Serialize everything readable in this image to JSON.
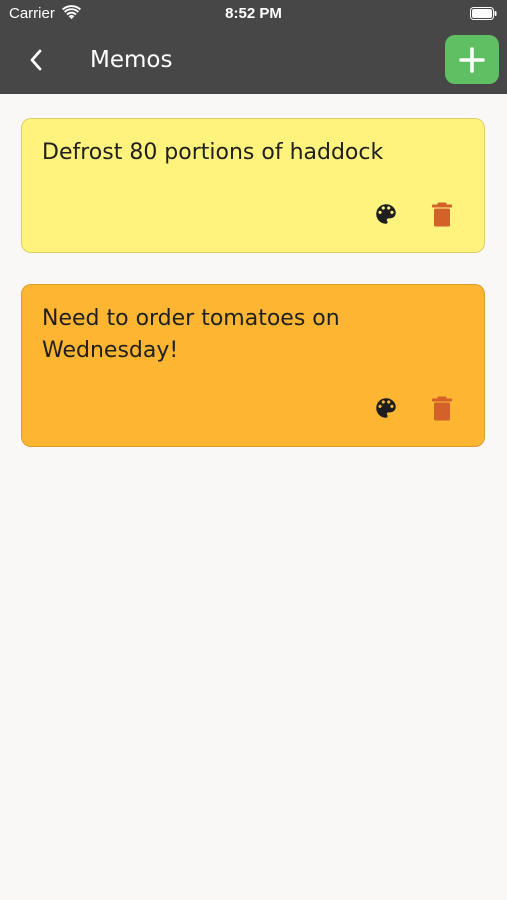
{
  "status_bar": {
    "carrier": "Carrier",
    "time": "8:52 PM",
    "wifi_icon": "wifi-icon",
    "battery_icon": "battery-icon"
  },
  "header": {
    "title": "Memos",
    "back_icon": "chevron-left-icon",
    "add_icon": "plus-icon",
    "background_color": "#474747",
    "add_button_color": "#5fc063"
  },
  "memos": [
    {
      "text": "Defrost 80 portions of haddock",
      "color": "#fff27d",
      "palette_icon": "palette-icon",
      "delete_icon": "trash-icon"
    },
    {
      "text": "Need to order tomatoes on Wednesday!",
      "color": "#feb632",
      "palette_icon": "palette-icon",
      "delete_icon": "trash-icon"
    }
  ],
  "colors": {
    "page_background": "#f9f8f6",
    "palette_icon": "#1e1e1e",
    "delete_icon": "#d2622a"
  }
}
